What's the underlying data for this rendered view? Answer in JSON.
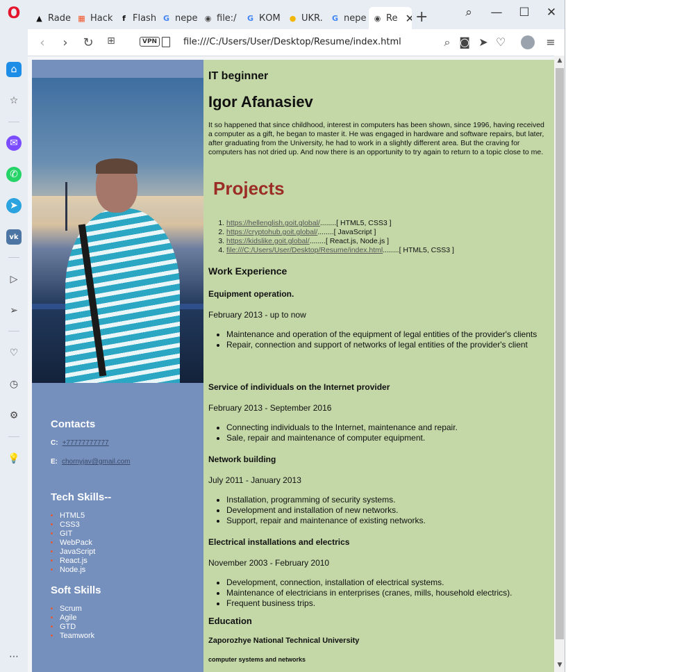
{
  "browser": {
    "tabs": [
      {
        "label": "Rade",
        "icon": "amd-icon",
        "glyph": "▲",
        "color": "#111111"
      },
      {
        "label": "Hack",
        "icon": "windows-icon",
        "glyph": "▦",
        "color": "#f25022"
      },
      {
        "label": "Flash",
        "icon": "flash-icon",
        "glyph": "f",
        "color": "#111111"
      },
      {
        "label": "nepe",
        "icon": "google-icon",
        "glyph": "G",
        "color": "#4285f4"
      },
      {
        "label": "file:/",
        "icon": "globe-icon",
        "glyph": "◉",
        "color": "#444444"
      },
      {
        "label": "КОМ",
        "icon": "google-icon",
        "glyph": "G",
        "color": "#4285f4"
      },
      {
        "label": "UKR.",
        "icon": "ukr-icon",
        "glyph": "●",
        "color": "#f2b705"
      },
      {
        "label": "nepe",
        "icon": "google-icon",
        "glyph": "G",
        "color": "#4285f4"
      },
      {
        "label": "Re",
        "icon": "globe-icon",
        "glyph": "◉",
        "color": "#444444",
        "active": true
      }
    ],
    "vpn_label": "VPN",
    "url": "file:///C:/Users/User/Desktop/Resume/index.html"
  },
  "resume": {
    "role": "IT beginner",
    "name": "Igor Afanasiev",
    "about": "It so happened that since childhood, interest in computers has been shown, since 1996, having received a computer as a gift, he began to master it. He was engaged in hardware and software repairs, but later, after graduating from the University, he had to work in a slightly different area. But the craving for computers has not dried up. And now there is an opportunity to try again to return to a topic close to me.",
    "projects_heading": "Projects",
    "projects": [
      {
        "url": "https://hellenglish.goit.global/",
        "tech": "........[ HTML5, CSS3 ]"
      },
      {
        "url": "https://cryptohub.goit.global/",
        "tech": "........[ JavaScript ]"
      },
      {
        "url": "https://kidslike.goit.global/",
        "tech": "........[ React.js, Node.js ]"
      },
      {
        "url": "file:///C:/Users/User/Desktop/Resume/index.html",
        "tech": "........[ HTML5, CSS3 ]"
      }
    ],
    "work_heading": "Work Experience",
    "jobs": [
      {
        "title": "Equipment operation.",
        "dates": "February 2013 - up to now",
        "duties": [
          "Maintenance and operation of the equipment of legal entities of the provider's clients",
          "Repair, connection and support of networks of legal entities of the provider's client"
        ]
      },
      {
        "title": "Service of individuals on the Internet provider",
        "dates": "February 2013 - September 2016",
        "duties": [
          "Connecting individuals to the Internet, maintenance and repair.",
          "Sale, repair and maintenance of computer equipment."
        ]
      },
      {
        "title": "Network building",
        "dates": "July 2011 - January 2013",
        "duties": [
          "Installation, programming of security systems.",
          "Development and installation of new networks.",
          "Support, repair and maintenance of existing networks."
        ]
      },
      {
        "title": "Electrical installations and electrics",
        "dates": "November 2003 - February 2010",
        "duties": [
          "Development, connection, installation of electrical systems.",
          "Maintenance of electricians in enterprises (cranes, mills, household electrics).",
          "Frequent business trips."
        ]
      }
    ],
    "education_heading": "Education",
    "university": "Zaporozhye National Technical University",
    "specialty": "computer systems and networks",
    "contacts_heading": "Contacts",
    "phone_label": "C:",
    "phone": "+77777777777",
    "email_label": "E:",
    "email": "chornyjav@gmail.com",
    "tech_heading": "Tech Skills--",
    "tech_skills": [
      "HTML5",
      "CSS3",
      "GIT",
      "WebPack",
      "JavaScript",
      "React.js",
      "Node.js"
    ],
    "soft_heading": "Soft Skills",
    "soft_skills": [
      "Scrum",
      "Agile",
      "GTD",
      "Teamwork"
    ]
  }
}
